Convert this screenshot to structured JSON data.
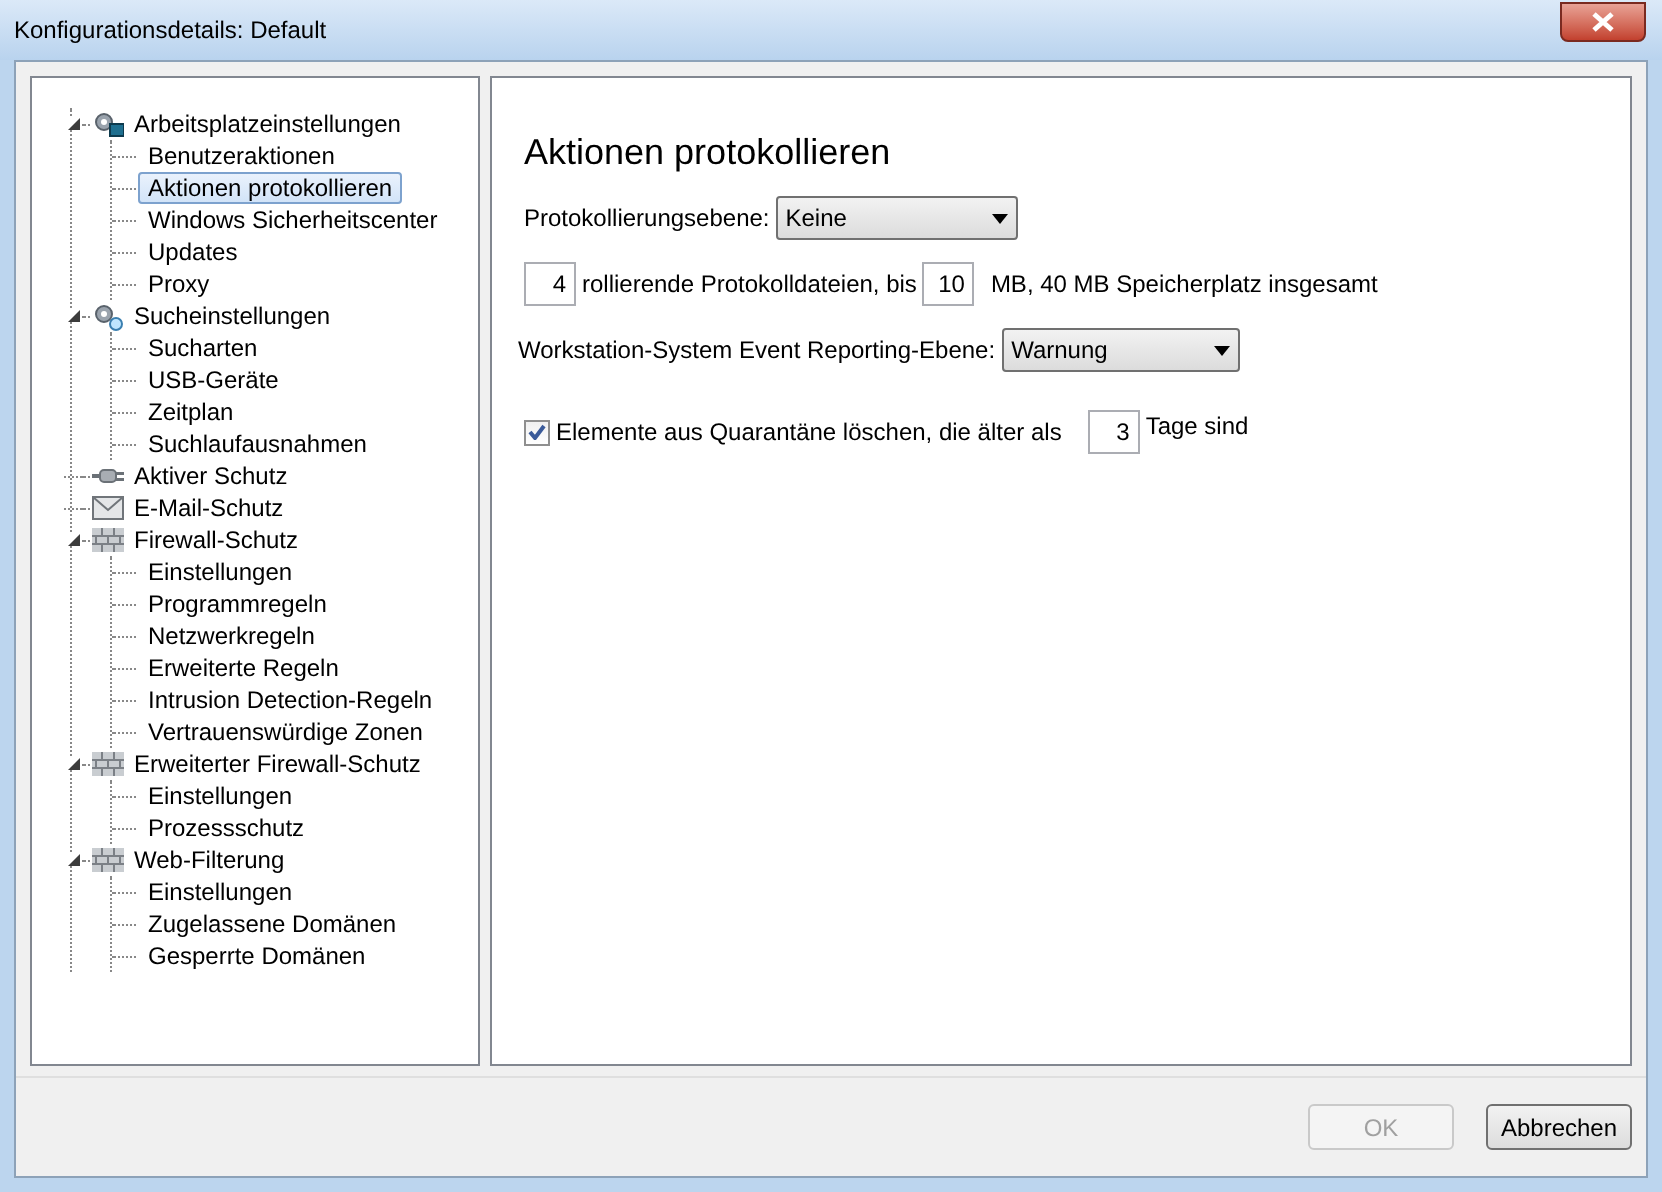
{
  "window": {
    "title": "Konfigurationsdetails: Default"
  },
  "tree": [
    {
      "label": "Arbeitsplatzeinstellungen",
      "kind": "workstation",
      "expanded": true,
      "children": [
        {
          "label": "Benutzeraktionen",
          "selected": false
        },
        {
          "label": "Aktionen protokollieren",
          "selected": true
        },
        {
          "label": "Windows Sicherheitscenter",
          "selected": false
        },
        {
          "label": "Updates",
          "selected": false
        },
        {
          "label": "Proxy",
          "selected": false
        }
      ]
    },
    {
      "label": "Sucheinstellungen",
      "kind": "search",
      "expanded": true,
      "children": [
        {
          "label": "Sucharten",
          "selected": false
        },
        {
          "label": "USB-Geräte",
          "selected": false
        },
        {
          "label": "Zeitplan",
          "selected": false
        },
        {
          "label": "Suchlaufausnahmen",
          "selected": false
        }
      ]
    },
    {
      "label": "Aktiver Schutz",
      "kind": "plug"
    },
    {
      "label": "E-Mail-Schutz",
      "kind": "mail"
    },
    {
      "label": "Firewall-Schutz",
      "kind": "wall",
      "expanded": true,
      "children": [
        {
          "label": "Einstellungen",
          "selected": false
        },
        {
          "label": "Programmregeln",
          "selected": false
        },
        {
          "label": "Netzwerkregeln",
          "selected": false
        },
        {
          "label": "Erweiterte Regeln",
          "selected": false
        },
        {
          "label": "Intrusion Detection-Regeln",
          "selected": false
        },
        {
          "label": "Vertrauenswürdige Zonen",
          "selected": false
        }
      ]
    },
    {
      "label": "Erweiterter Firewall-Schutz",
      "kind": "wall",
      "expanded": true,
      "children": [
        {
          "label": "Einstellungen",
          "selected": false
        },
        {
          "label": "Prozessschutz",
          "selected": false
        }
      ]
    },
    {
      "label": "Web-Filterung",
      "kind": "wall",
      "expanded": true,
      "children": [
        {
          "label": "Einstellungen",
          "selected": false
        },
        {
          "label": "Zugelassene Domänen",
          "selected": false
        },
        {
          "label": "Gesperrte Domänen",
          "selected": false
        }
      ]
    }
  ],
  "panel": {
    "heading": "Aktionen protokollieren",
    "log_level": {
      "label": "Protokollierungsebene:",
      "value": "Keine"
    },
    "rolling": {
      "count": "4",
      "text_1": "rollierende Protokolldateien, bis",
      "size": "10",
      "text_2": "MB, 40 MB Speicherplatz insgesamt"
    },
    "event_level": {
      "label": "Workstation-System Event Reporting-Ebene:",
      "value": "Warnung"
    },
    "quarantine": {
      "checked": true,
      "text_1": "Elemente aus Quarantäne löschen, die älter als",
      "days": "3",
      "text_2": "Tage sind"
    }
  },
  "buttons": [
    {
      "label": "OK",
      "disabled": true
    },
    {
      "label": "Abbrechen",
      "disabled": false
    }
  ]
}
